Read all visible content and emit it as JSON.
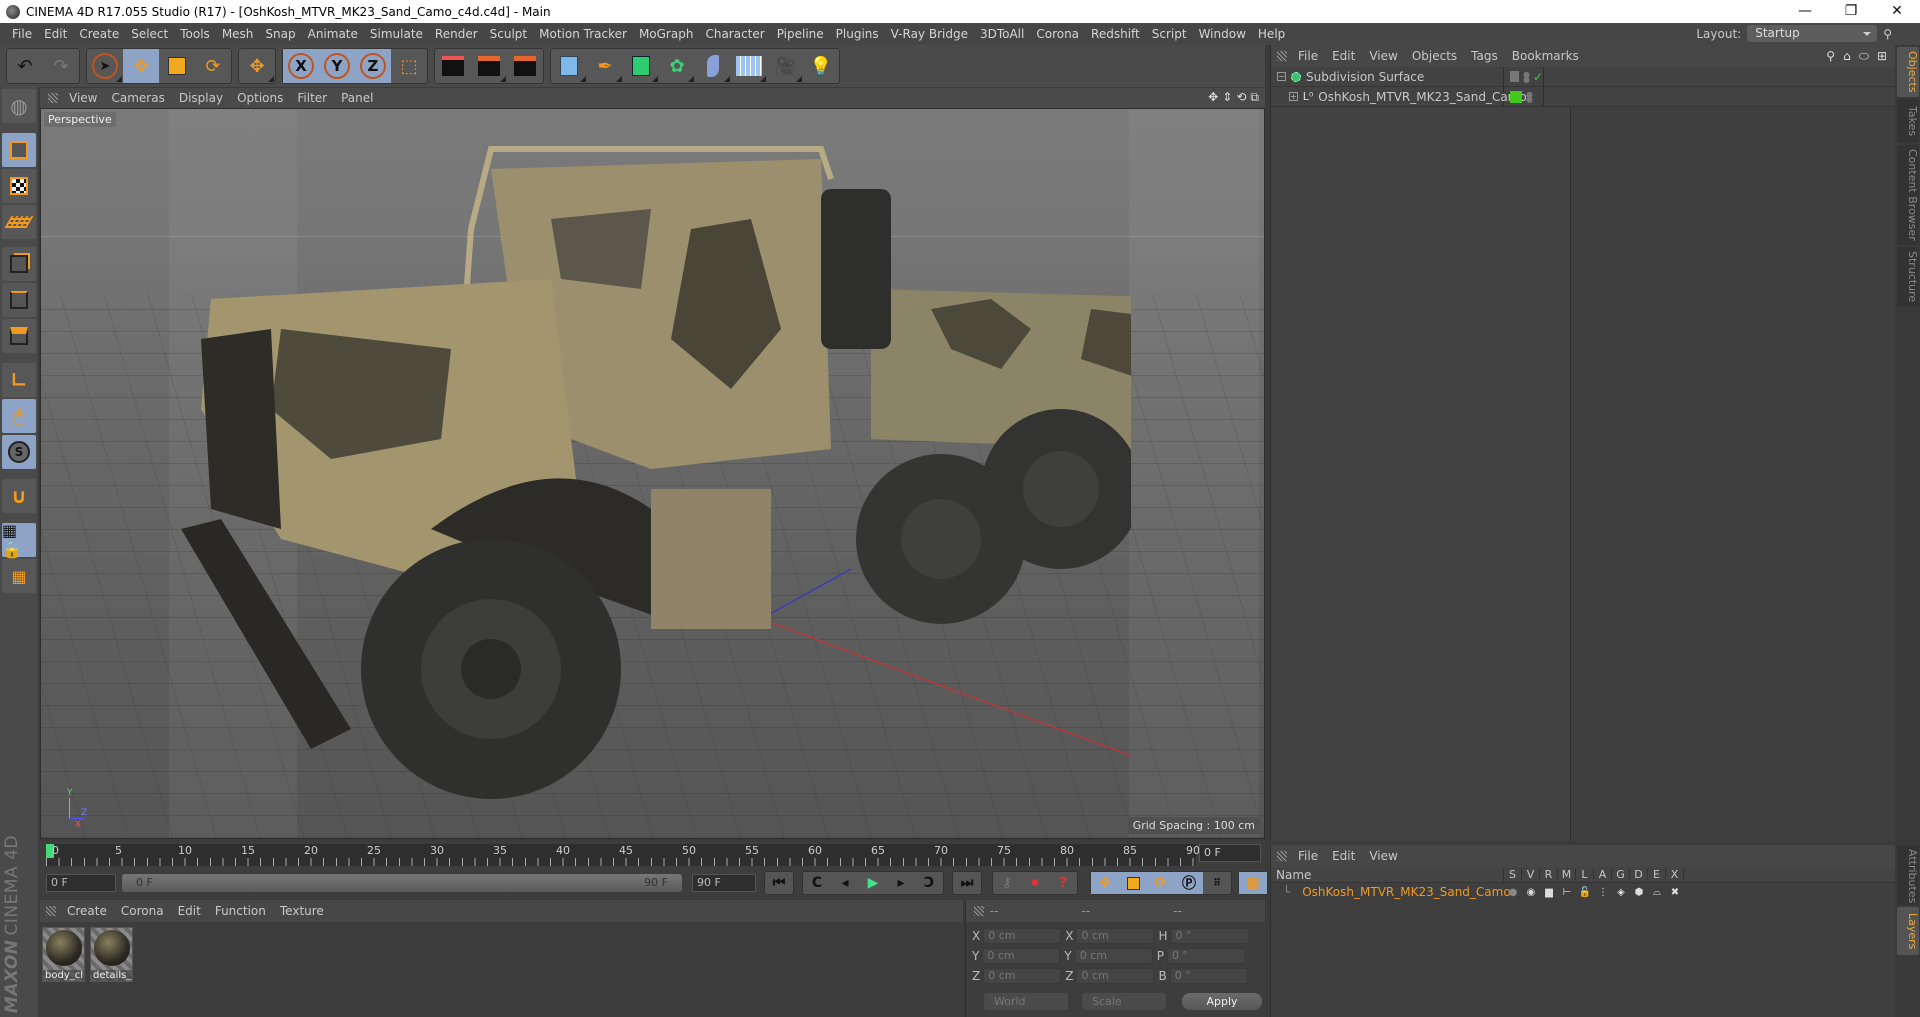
{
  "window": {
    "title": "CINEMA 4D R17.055 Studio (R17) - [OshKosh_MTVR_MK23_Sand_Camo_c4d.c4d] - Main",
    "controls": {
      "minimize": "—",
      "restore": "❐",
      "close": "✕"
    }
  },
  "menubar": {
    "items": [
      "File",
      "Edit",
      "Create",
      "Select",
      "Tools",
      "Mesh",
      "Snap",
      "Animate",
      "Simulate",
      "Render",
      "Sculpt",
      "Motion Tracker",
      "MoGraph",
      "Character",
      "Pipeline",
      "Plugins",
      "V-Ray Bridge",
      "3DToAll",
      "Corona",
      "Redshift",
      "Script",
      "Window",
      "Help"
    ],
    "layout_label": "Layout:",
    "layout_value": "Startup"
  },
  "toolbar": {
    "axis_labels": [
      "X",
      "Y",
      "Z"
    ]
  },
  "viewport": {
    "menu": [
      "View",
      "Cameras",
      "Display",
      "Options",
      "Filter",
      "Panel"
    ],
    "camera_label": "Perspective",
    "grid_spacing": "Grid Spacing : 100 cm",
    "axis_gizmo": {
      "y": "Y",
      "z": "Z",
      "x": "X"
    }
  },
  "object_manager": {
    "menu": [
      "File",
      "Edit",
      "View",
      "Objects",
      "Tags",
      "Bookmarks"
    ],
    "objects": [
      {
        "name": "Subdivision Surface",
        "expanded": true,
        "enabled": true
      },
      {
        "name": "OshKosh_MTVR_MK23_Sand_Camo",
        "expanded": false,
        "color": "#41c91c"
      }
    ]
  },
  "side_tabs": {
    "top": [
      "Objects",
      "Takes",
      "Content Browser",
      "Structure"
    ],
    "bottom": [
      "Attributes",
      "Layers"
    ],
    "active_top": "Objects",
    "active_bottom": "Layers"
  },
  "timeline": {
    "ticks": [
      "0",
      "5",
      "10",
      "15",
      "20",
      "25",
      "30",
      "35",
      "40",
      "45",
      "50",
      "55",
      "60",
      "65",
      "70",
      "75",
      "80",
      "85",
      "90"
    ],
    "current_frame": "0 F",
    "start_field": "0 F",
    "range_start": "0 F",
    "range_end": "90 F",
    "end_field": "90 F",
    "current_frame_right": "0 F"
  },
  "material_manager": {
    "menu": [
      "Create",
      "Corona",
      "Edit",
      "Function",
      "Texture"
    ],
    "materials": [
      {
        "label": "body_cl"
      },
      {
        "label": "details_"
      }
    ],
    "brand_top": "MAXON",
    "brand_bottom": "CINEMA 4D"
  },
  "coordinates": {
    "headers": [
      "--",
      "--",
      "--"
    ],
    "rows": [
      {
        "a_label": "X",
        "a_val": "0 cm",
        "b_label": "X",
        "b_val": "0 cm",
        "c_label": "H",
        "c_val": "0 °"
      },
      {
        "a_label": "Y",
        "a_val": "0 cm",
        "b_label": "Y",
        "b_val": "0 cm",
        "c_label": "P",
        "c_val": "0 °"
      },
      {
        "a_label": "Z",
        "a_val": "0 cm",
        "b_label": "Z",
        "b_val": "0 cm",
        "c_label": "B",
        "c_val": "0 °"
      }
    ],
    "mode": "World",
    "type": "Scale",
    "apply_label": "Apply"
  },
  "layer_manager": {
    "menu": [
      "File",
      "Edit",
      "View"
    ],
    "columns": [
      "Name",
      "S",
      "V",
      "R",
      "M",
      "L",
      "A",
      "G",
      "D",
      "E",
      "X"
    ],
    "layers": [
      {
        "name": "OshKosh_MTVR_MK23_Sand_Camo",
        "color": "#41c91c"
      }
    ]
  },
  "colors": {
    "accent_orange": "#f29a1f",
    "active_blue": "#8ea4c6",
    "layer_green": "#41c91c",
    "playhead_green": "#45d97a"
  }
}
